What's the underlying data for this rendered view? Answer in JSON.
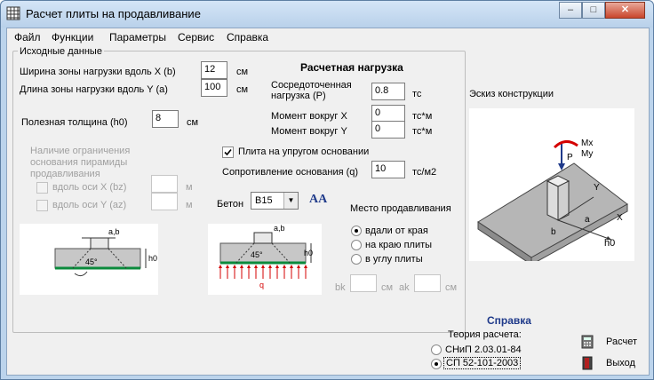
{
  "window": {
    "title": "Расчет плиты на продавливание",
    "minimize_glyph": "‒",
    "maximize_glyph": "□",
    "close_glyph": "✕"
  },
  "menu": [
    "Файл",
    "Функции",
    "Параметры",
    "Сервис",
    "Справка"
  ],
  "initial": {
    "legend": "Исходные данные",
    "width_x_label": "Ширина зоны нагрузки вдоль X (b)",
    "width_x_value": "12",
    "width_x_unit": "см",
    "length_y_label": "Длина зоны нагрузки вдоль Y (a)",
    "length_y_value": "100",
    "length_y_unit": "см",
    "thickness_label": "Полезная толщина (h0)",
    "thickness_value": "8",
    "thickness_unit": "см",
    "limit_text": "Наличие ограничения основания пирамиды продавливания",
    "limit_x_label": "вдоль оси X (bz)",
    "limit_x_unit": "м",
    "limit_y_label": "вдоль оси Y (az)",
    "limit_y_unit": "м"
  },
  "load": {
    "title": "Расчетная нагрузка",
    "p_label": "Сосредоточенная нагрузка (P)",
    "p_value": "0.8",
    "p_unit": "тс",
    "mx_label": "Момент вокруг X",
    "mx_value": "0",
    "mx_unit": "тс*м",
    "my_label": "Момент вокруг Y",
    "my_value": "0",
    "my_unit": "тс*м",
    "elastic_label": "Плита на упругом основании",
    "elastic_checked": true,
    "resist_label": "Сопротивление основания (q)",
    "resist_value": "10",
    "resist_unit": "тс/м2"
  },
  "concrete": {
    "label": "Бетон",
    "value": "B15",
    "icon": "AA"
  },
  "diagram": {
    "ab_label": "a,b",
    "angle_label": "45°",
    "h0_label": "h0",
    "q_label": "q"
  },
  "location": {
    "title": "Место продавливания",
    "options": [
      "вдали от края",
      "на краю плиты",
      "в углу плиты"
    ],
    "selected_index": 0,
    "bk_label": "bk",
    "bk_unit": "см",
    "ak_label": "ak",
    "ak_unit": "см"
  },
  "sketch": {
    "title": "Эскиз конструкции",
    "mx": "Mx",
    "my": "My",
    "p": "P",
    "x": "X",
    "y": "Y",
    "a": "a",
    "b": "b",
    "h0": "h0"
  },
  "help": {
    "title": "Справка",
    "theory_label": "Теория расчета:",
    "theory_options": [
      "СНиП 2.03.01-84",
      "СП 52-101-2003"
    ],
    "theory_selected": 1
  },
  "buttons": {
    "calc": "Расчет",
    "exit": "Выход"
  },
  "colors": {
    "accent_blue": "#1f3a8a",
    "slab_green": "#0b8a3c",
    "load_red": "#d40000"
  }
}
